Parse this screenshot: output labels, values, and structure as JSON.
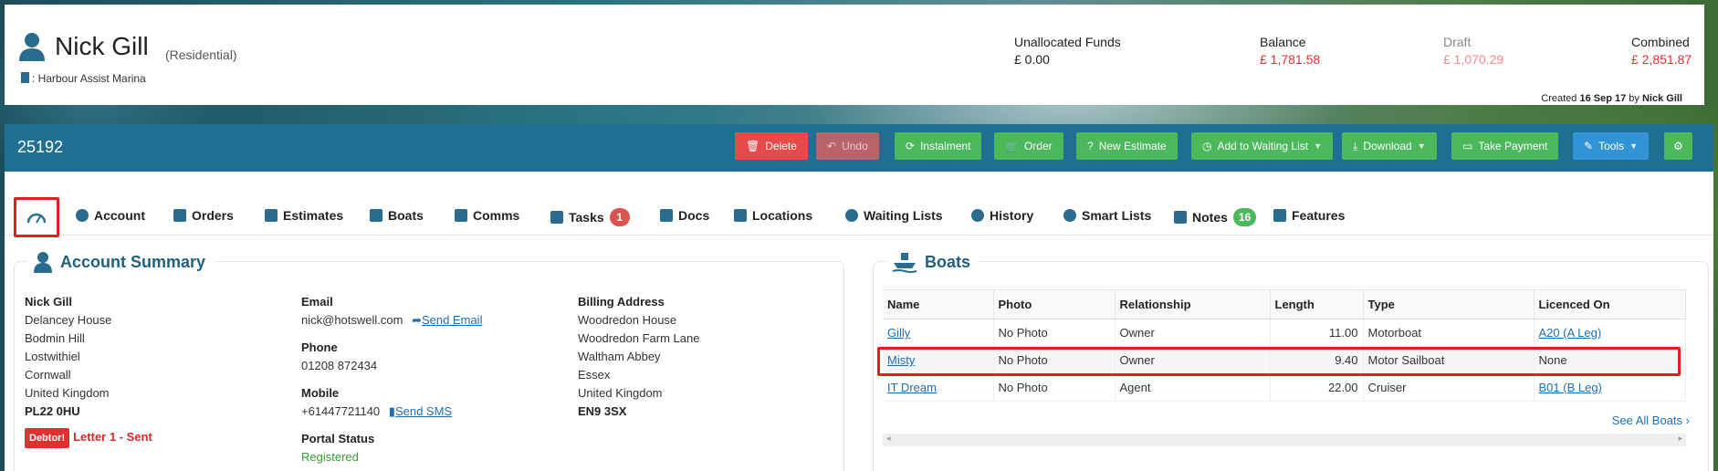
{
  "customer": {
    "name": "Nick Gill",
    "type": "(Residential)",
    "marina": ": Harbour Assist Marina"
  },
  "funds": [
    {
      "label": "Unallocated Funds",
      "value": "£ 0.00"
    },
    {
      "label": "Balance",
      "value": "£ 1,781.58"
    },
    {
      "label": "Draft",
      "value": "£ 1,070.29"
    },
    {
      "label": "Combined",
      "value": "£ 2,851.87"
    }
  ],
  "created": {
    "prefix": "Created",
    "date": "16 Sep 17",
    "by": "by",
    "user": "Nick Gill"
  },
  "action_bar": {
    "ref": "25192",
    "buttons": {
      "delete": "Delete",
      "undo": "Undo",
      "instalment": "Instalment",
      "order": "Order",
      "new_estimate": "New Estimate",
      "waiting_list": "Add to Waiting List",
      "download": "Download",
      "take_payment": "Take Payment",
      "tools": "Tools"
    }
  },
  "tabs": {
    "account": "Account",
    "orders": "Orders",
    "estimates": "Estimates",
    "boats": "Boats",
    "comms": "Comms",
    "tasks": "Tasks",
    "tasks_count": "1",
    "docs": "Docs",
    "locations": "Locations",
    "waiting_lists": "Waiting Lists",
    "history": "History",
    "smart_lists": "Smart Lists",
    "notes": "Notes",
    "notes_count": "16",
    "features": "Features"
  },
  "account_summary": {
    "title": "Account Summary",
    "address": {
      "name": "Nick Gill",
      "lines": [
        "Delancey House",
        "Bodmin Hill",
        "Lostwithiel",
        "Cornwall",
        "United Kingdom"
      ],
      "postcode": "PL22 0HU"
    },
    "email_label": "Email",
    "email": "nick@hotswell.com",
    "send_email": "Send Email",
    "phone_label": "Phone",
    "phone": "01208 872434",
    "mobile_label": "Mobile",
    "mobile": "+61447721140",
    "send_sms": "Send SMS",
    "portal_label": "Portal Status",
    "portal_value": "Registered",
    "billing_label": "Billing Address",
    "billing_lines": [
      "Woodredon House",
      "Woodredon Farm Lane",
      "Waltham Abbey",
      "Essex",
      "United Kingdom"
    ],
    "billing_postcode": "EN9 3SX",
    "debtor_badge": "Debtor!",
    "letter_status": "Letter 1 - Sent"
  },
  "boats_panel": {
    "title": "Boats",
    "headers": [
      "Name",
      "Photo",
      "Relationship",
      "Length",
      "Type",
      "Licenced On"
    ],
    "rows": [
      {
        "name": "Gilly",
        "photo": "No Photo",
        "relationship": "Owner",
        "length": "11.00",
        "type": "Motorboat",
        "licenced": "A20 (A Leg)"
      },
      {
        "name": "Misty",
        "photo": "No Photo",
        "relationship": "Owner",
        "length": "9.40",
        "type": "Motor Sailboat",
        "licenced": "None"
      },
      {
        "name": "IT Dream",
        "photo": "No Photo",
        "relationship": "Agent",
        "length": "22.00",
        "type": "Cruiser",
        "licenced": "B01 (B Leg)"
      }
    ],
    "see_all": "See All Boats"
  },
  "colors": {
    "primary_bar": "#1f6f93",
    "danger": "#e84a4a",
    "success": "#4cb85c",
    "info": "#3294d6",
    "highlight": "#e02020"
  }
}
